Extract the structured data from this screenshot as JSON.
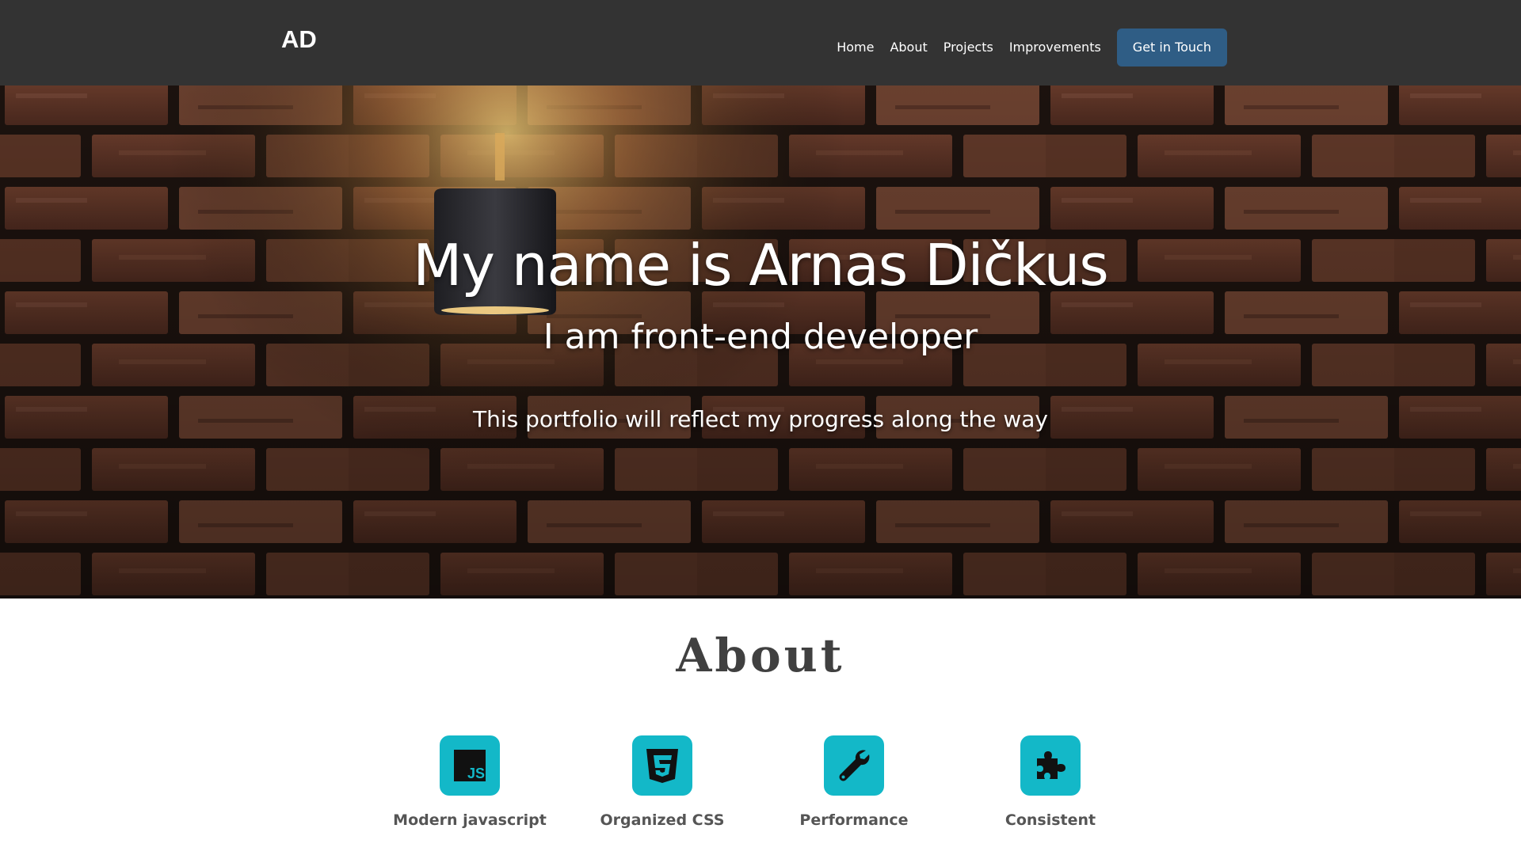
{
  "navbar": {
    "brand": "AD",
    "links": [
      {
        "label": "Home"
      },
      {
        "label": "About"
      },
      {
        "label": "Projects"
      },
      {
        "label": "Improvements"
      }
    ],
    "cta_label": "Get in Touch",
    "background_color": "#333333",
    "cta_color": "#2f5d85"
  },
  "hero": {
    "title": "My name is Arnas Dičkus",
    "subtitle": "I am front-end developer",
    "tagline": "This portfolio will reflect my progress along the way",
    "background": "brick wall with wall lamp"
  },
  "about": {
    "title": "About",
    "accent_color": "#13b8c8",
    "features": [
      {
        "label": "Modern javascript",
        "icon": "js-icon"
      },
      {
        "label": "Organized CSS",
        "icon": "css3-icon"
      },
      {
        "label": "Performance",
        "icon": "wrench-icon"
      },
      {
        "label": "Consistent",
        "icon": "puzzle-icon"
      }
    ]
  }
}
